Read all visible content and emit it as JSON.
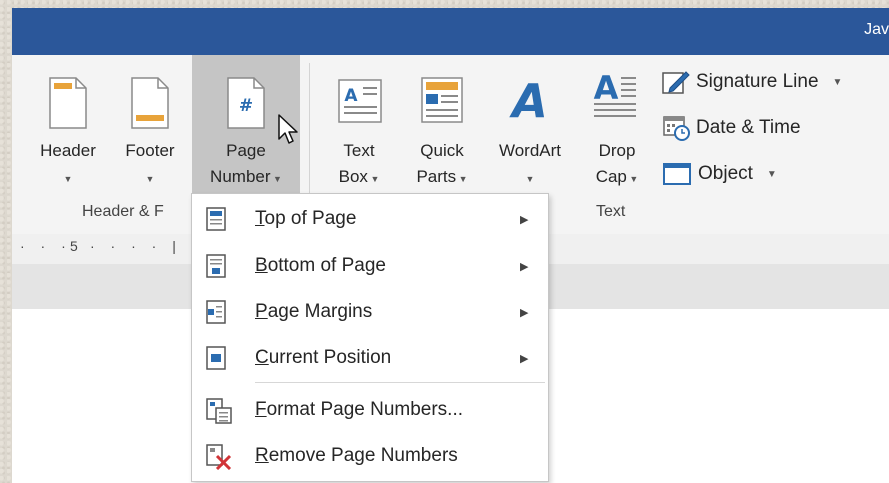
{
  "window": {
    "title_partial": "Jav"
  },
  "ribbon": {
    "header_footer_group": {
      "label": "Header & F",
      "header": {
        "label": "Header"
      },
      "footer": {
        "label": "Footer"
      },
      "page_number": {
        "label_line1": "Page",
        "label_line2": "Number"
      }
    },
    "text_group": {
      "label": "Text",
      "text_box": {
        "label_line1": "Text",
        "label_line2": "Box"
      },
      "quick_parts": {
        "label_line1": "Quick",
        "label_line2": "Parts"
      },
      "wordart": {
        "label": "WordArt"
      },
      "drop_cap": {
        "label_line1": "Drop",
        "label_line2": "Cap"
      },
      "signature_line": {
        "label": "Signature Line"
      },
      "date_time": {
        "label": "Date & Time"
      },
      "object": {
        "label": "Object"
      }
    }
  },
  "ruler": {
    "mark": "5"
  },
  "page_number_menu": {
    "items": [
      {
        "label": "Top of Page",
        "accel": "T",
        "rest": "op of Page",
        "submenu": true
      },
      {
        "label": "Bottom of Page",
        "accel": "B",
        "rest": "ottom of Page",
        "submenu": true
      },
      {
        "label": "Page Margins",
        "accel": "P",
        "rest": "age Margins",
        "submenu": true
      },
      {
        "label": "Current Position",
        "accel": "C",
        "rest": "urrent Position",
        "submenu": true
      },
      {
        "label": "Format Page Numbers...",
        "accel": "F",
        "rest": "ormat Page Numbers...",
        "submenu": false
      },
      {
        "label": "Remove Page Numbers",
        "accel": "R",
        "rest": "emove Page Numbers",
        "submenu": false
      }
    ]
  },
  "colors": {
    "titlebar": "#2b579a",
    "accent_blue": "#2b6cb0",
    "accent_orange": "#e8a33a",
    "remove_red": "#d13438"
  }
}
